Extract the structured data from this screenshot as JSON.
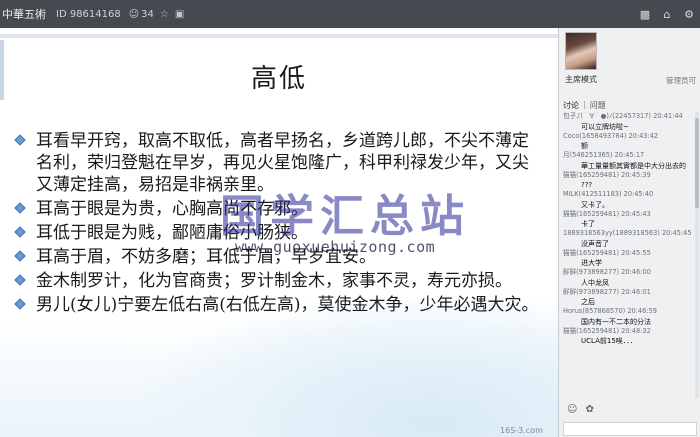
{
  "topbar": {
    "title": "中華五術",
    "room_id": "ID 98614168",
    "user_count": "34",
    "icons": [
      "user-icon",
      "star-icon",
      "share-icon",
      "chat-icon",
      "home-icon",
      "settings-icon"
    ]
  },
  "slide": {
    "title": "高低",
    "bullets": [
      "耳看早开窍，取高不取低，高者早扬名，乡道跨儿郎，不尖不薄定名利，荣归登魁在早岁，再见火星饱隆广，科甲利禄发少年，又尖又薄定挂高，易招是非祸亲里。",
      "耳高于眼是为贵，心胸高尚不存邪。",
      "耳低于眼是为贱，鄙陋庸俗小肠狭。",
      "耳高于眉，不妨多磨；耳低于眉，早岁宜安。",
      "金木制罗计，化为官商贵；罗计制金木，家事不灵，寿元亦损。",
      "男儿(女儿)宁要左低右高(右低左高)，莫使金木争，少年必遇大灾。"
    ],
    "watermark_big": "国学汇总站",
    "watermark_url": "www.guoxuehuizong.com",
    "watermark_small": "16S-3.com"
  },
  "panel": {
    "mode_label": "主席模式",
    "admin_label": "管理员可",
    "tabs": [
      {
        "label": "讨论",
        "active": true
      },
      {
        "label": "问题",
        "active": false
      }
    ],
    "messages": [
      {
        "head": "包子♪(＾∀＾●)ﾉ(22457317) 20:41:44",
        "body": ""
      },
      {
        "head": "",
        "body": "可以立牌坊啦~"
      },
      {
        "head": "Coco(1658493784) 20:43:42",
        "body": ""
      },
      {
        "head": "",
        "body": "额"
      },
      {
        "head": "月(546251365) 20:45:17",
        "body": ""
      },
      {
        "head": "",
        "body": "華工量量额其實都是中大分出去的"
      },
      {
        "head": "猫猫(165259481) 20:45:39",
        "body": ""
      },
      {
        "head": "",
        "body": "???"
      },
      {
        "head": "MILK(412511183) 20:45:40",
        "body": ""
      },
      {
        "head": "",
        "body": "又卡了。"
      },
      {
        "head": "猫猫(165259481) 20:45:43",
        "body": ""
      },
      {
        "head": "",
        "body": "卡了"
      },
      {
        "head": "1889318563yy(1889318563) 20:45:45",
        "body": ""
      },
      {
        "head": "",
        "body": "没声音了"
      },
      {
        "head": "猫猫(165259481) 20:45:55",
        "body": ""
      },
      {
        "head": "",
        "body": "进大学"
      },
      {
        "head": "鲜鲜(973898277) 20:46:00",
        "body": ""
      },
      {
        "head": "",
        "body": "人中龙凤"
      },
      {
        "head": "鲜鲜(973898277) 20:46:01",
        "body": ""
      },
      {
        "head": "",
        "body": "之后"
      },
      {
        "head": "Horus(857868570) 20:46:59",
        "body": ""
      },
      {
        "head": "",
        "body": "国内有一不二本的分法"
      },
      {
        "head": "猫猫(165259481) 20:48:32",
        "body": ""
      },
      {
        "head": "",
        "body": "UCLA前15唉．．．"
      }
    ]
  }
}
